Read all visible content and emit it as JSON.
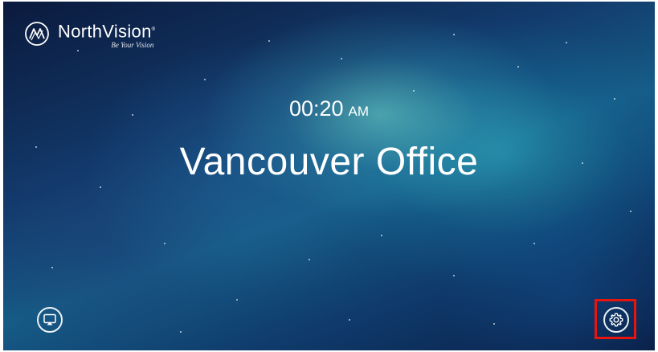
{
  "brand": {
    "name": "NorthVision",
    "registered_mark": "®",
    "tagline": "Be Your Vision"
  },
  "clock": {
    "time": "00:20",
    "ampm": "AM"
  },
  "room": {
    "name": "Vancouver Office"
  },
  "icons": {
    "screen_share": "screen-cast-icon",
    "settings": "gear-icon",
    "logo": "northvision-logo-icon"
  },
  "colors": {
    "text": "#ffffff",
    "highlight": "#e8150f"
  }
}
